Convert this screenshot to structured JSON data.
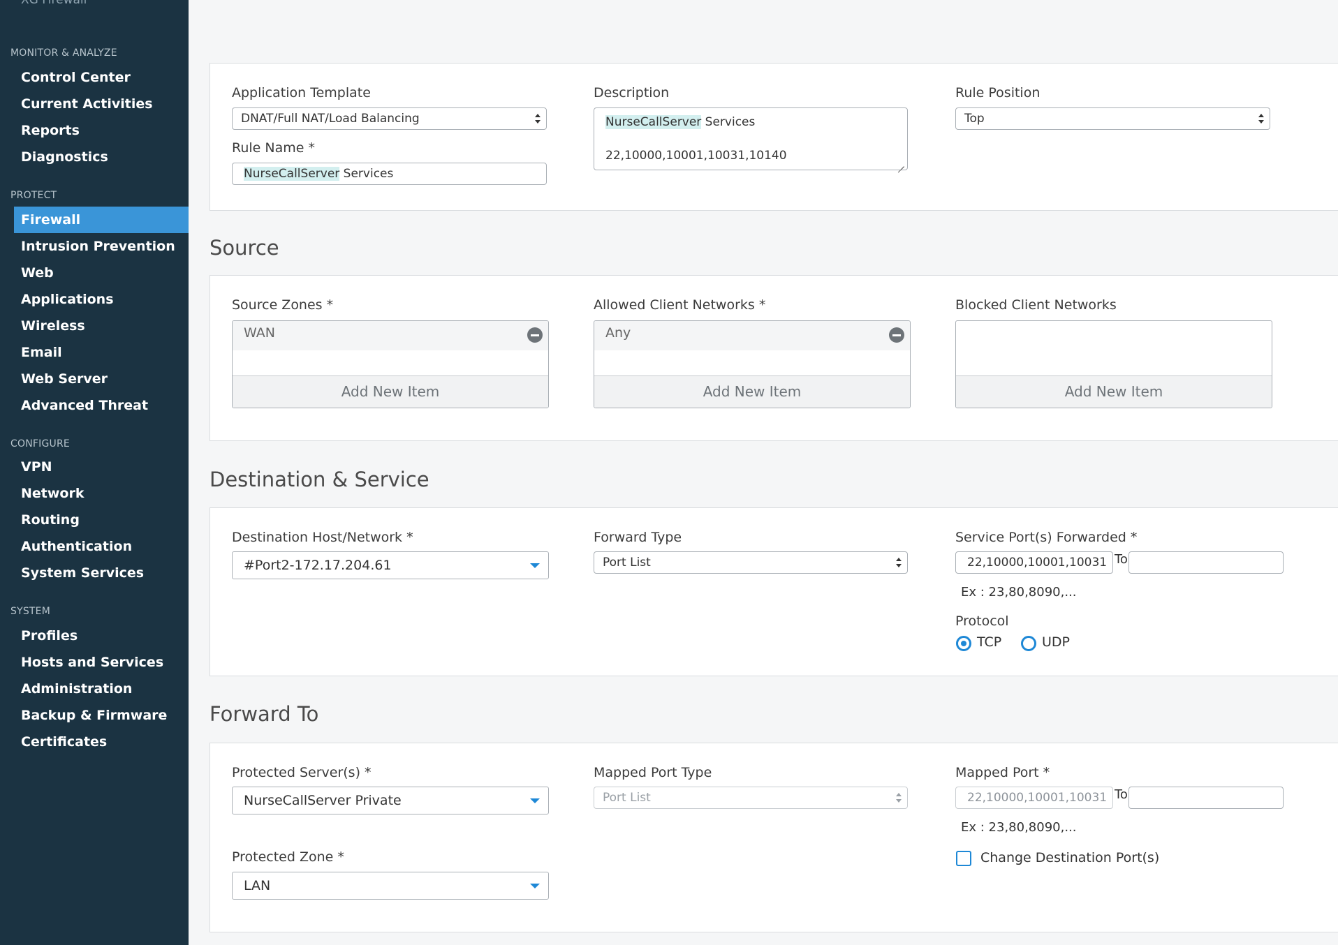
{
  "sidebar": {
    "brand": "XG Firewall",
    "sections": [
      {
        "title": "MONITOR & ANALYZE",
        "items": [
          "Control Center",
          "Current Activities",
          "Reports",
          "Diagnostics"
        ]
      },
      {
        "title": "PROTECT",
        "items": [
          "Firewall",
          "Intrusion Prevention",
          "Web",
          "Applications",
          "Wireless",
          "Email",
          "Web Server",
          "Advanced Threat"
        ]
      },
      {
        "title": "CONFIGURE",
        "items": [
          "VPN",
          "Network",
          "Routing",
          "Authentication",
          "System Services"
        ]
      },
      {
        "title": "SYSTEM",
        "items": [
          "Profiles",
          "Hosts and Services",
          "Administration",
          "Backup & Firmware",
          "Certificates"
        ]
      }
    ],
    "active_item": "Firewall"
  },
  "general": {
    "app_template_label": "Application Template",
    "app_template_value": "DNAT/Full NAT/Load Balancing",
    "rule_name_label": "Rule Name *",
    "rule_name_highlight": "NurseCallServer",
    "rule_name_rest": " Services",
    "description_label": "Description",
    "description_line1_highlight": "NurseCallServer",
    "description_line1_rest": " Services",
    "description_line2": "22,10000,10001,10031,10140",
    "rule_position_label": "Rule Position",
    "rule_position_value": "Top"
  },
  "source": {
    "heading": "Source",
    "zones_label": "Source Zones *",
    "zones_item": "WAN",
    "allowed_label": "Allowed Client Networks *",
    "allowed_item": "Any",
    "blocked_label": "Blocked Client Networks",
    "add_new_item": "Add New Item"
  },
  "destination": {
    "heading": "Destination & Service",
    "host_label": "Destination Host/Network *",
    "host_value": "#Port2-172.17.204.61",
    "forward_type_label": "Forward Type",
    "forward_type_value": "Port List",
    "service_ports_label": "Service Port(s) Forwarded *",
    "service_ports_value": "22,10000,10001,10031",
    "to_label": "To",
    "to_value": "",
    "example": "Ex : 23,80,8090,...",
    "protocol_label": "Protocol",
    "protocol_options": [
      "TCP",
      "UDP"
    ],
    "protocol_selected": "TCP"
  },
  "forward_to": {
    "heading": "Forward To",
    "protected_server_label": "Protected Server(s) *",
    "protected_server_value": "NurseCallServer Private",
    "mapped_port_type_label": "Mapped Port Type",
    "mapped_port_type_value": "Port List",
    "mapped_port_label": "Mapped Port *",
    "mapped_port_value": "22,10000,10001,10031",
    "to_label": "To",
    "to_value": "",
    "example": "Ex : 23,80,8090,...",
    "change_dest_label": "Change Destination Port(s)",
    "protected_zone_label": "Protected Zone *",
    "protected_zone_value": "LAN"
  },
  "colors": {
    "sidebar_bg": "#1b3342",
    "active_item_bg": "#3a95d8",
    "accent_blue": "#1e88d6",
    "highlight": "#d3efef"
  }
}
